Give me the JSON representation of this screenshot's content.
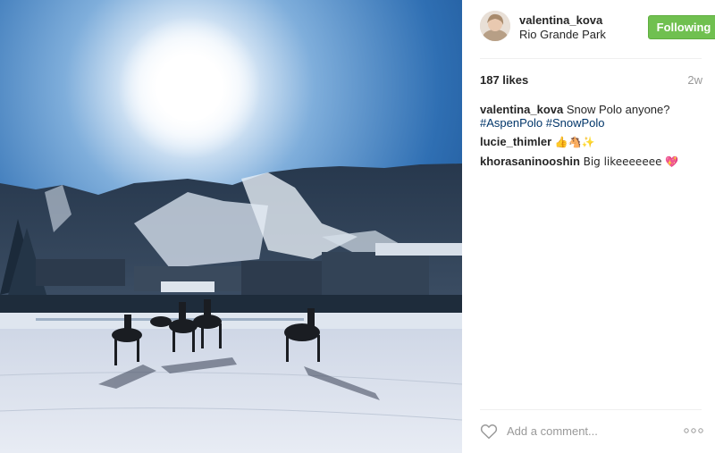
{
  "post": {
    "photo_alt": "image",
    "username": "valentina_kova",
    "location": "Rio Grande Park",
    "follow_label": "Following",
    "likes": "187 likes",
    "age": "2w",
    "caption": {
      "user": "valentina_kova",
      "text": "Snow Polo anyone?",
      "hashtags": [
        "#AspenPolo",
        "#SnowPolo"
      ]
    },
    "comments": [
      {
        "user": "lucie_thimler",
        "text": "👍🐴✨"
      },
      {
        "user": "khorasaninooshin",
        "text": "Big likeeeeeee 💖"
      }
    ],
    "add_comment_placeholder": "Add a comment...",
    "icons": {
      "like": "heart-outline-icon",
      "more": "more-options-icon"
    },
    "colors": {
      "follow_button": "#70c050",
      "hashtag": "#003569"
    }
  }
}
